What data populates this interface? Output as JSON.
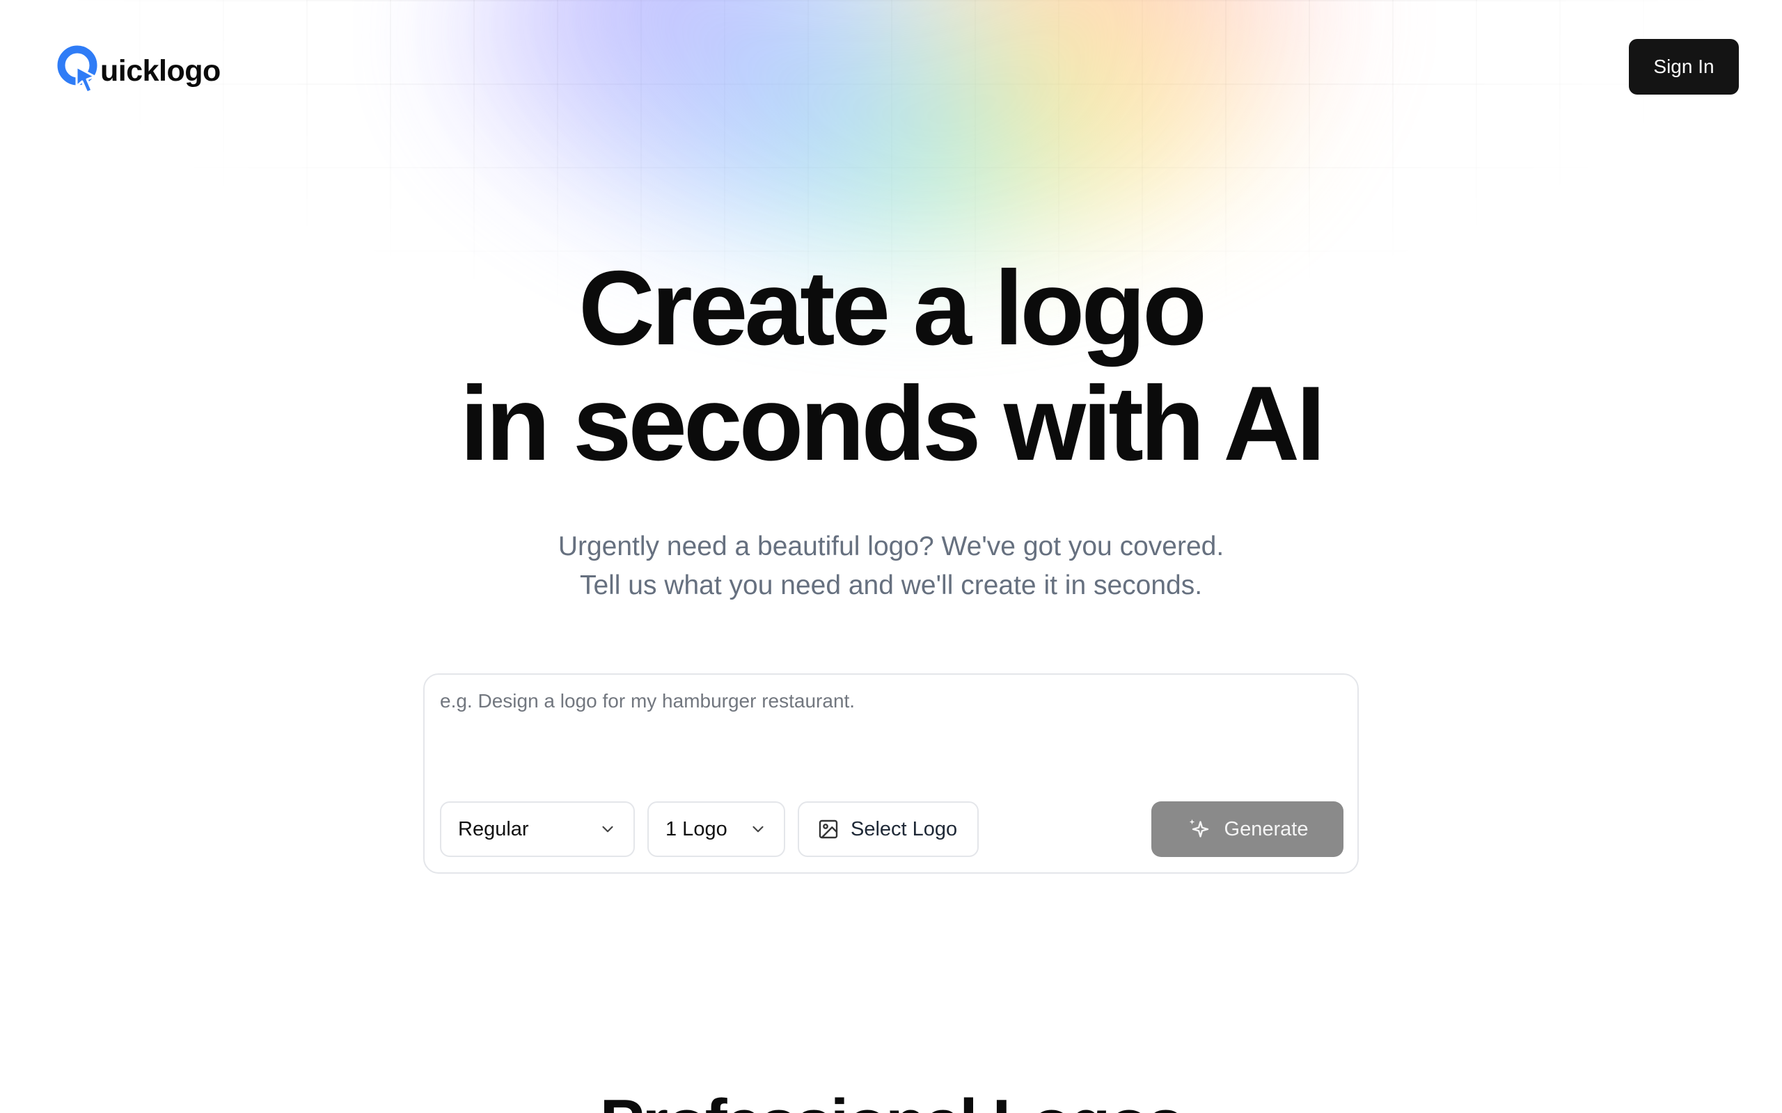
{
  "brand": {
    "name": "uicklogo",
    "accent_color": "#2f7cf6",
    "mark_icon": "q-cursor-logo-icon"
  },
  "header": {
    "sign_in_label": "Sign In"
  },
  "hero": {
    "title_line1": "Create a logo",
    "title_line2": "in seconds with AI",
    "subtitle_line1": "Urgently need a beautiful logo? We've got you covered.",
    "subtitle_line2": "Tell us what you need and we'll create it in seconds."
  },
  "prompt_card": {
    "input_value": "",
    "input_placeholder": "e.g. Design a logo for my hamburger restaurant.",
    "style_select": {
      "selected": "Regular",
      "icon": "chevron-down-icon"
    },
    "count_select": {
      "selected": "1 Logo",
      "icon": "chevron-down-icon"
    },
    "select_logo": {
      "label": "Select Logo",
      "icon": "image-icon"
    },
    "generate": {
      "label": "Generate",
      "icon": "sparkle-icon",
      "color": "#8a8a8a"
    }
  },
  "next_section": {
    "heading": "Professional Logos"
  }
}
